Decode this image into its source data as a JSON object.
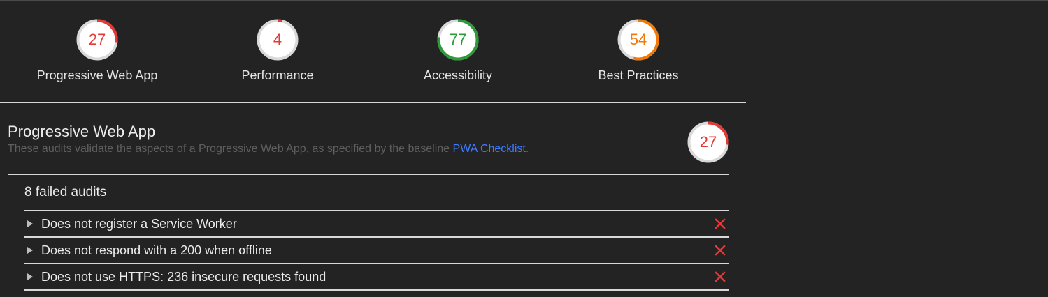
{
  "scores": [
    {
      "label": "Progressive Web App",
      "value": "27",
      "fraction": 0.27,
      "color": "#e53935"
    },
    {
      "label": "Performance",
      "value": "4",
      "fraction": 0.04,
      "color": "#e53935"
    },
    {
      "label": "Accessibility",
      "value": "77",
      "fraction": 0.77,
      "color": "#2e9b3a"
    },
    {
      "label": "Best Practices",
      "value": "54",
      "fraction": 0.54,
      "color": "#f07a0a"
    }
  ],
  "section": {
    "title": "Progressive Web App",
    "description": "These audits validate the aspects of a Progressive Web App, as specified by the baseline ",
    "link_text": "PWA Checklist",
    "description_end": ".",
    "score": "27",
    "fraction": 0.27,
    "color": "#e53935"
  },
  "failed": {
    "title": "8 failed audits",
    "audits": [
      "Does not register a Service Worker",
      "Does not respond with a 200 when offline",
      "Does not use HTTPS: 236 insecure requests found"
    ]
  },
  "colors": {
    "fail": "#e53935",
    "gauge_bg": "#d9d9d9",
    "gauge_fill": "#ffffff"
  }
}
